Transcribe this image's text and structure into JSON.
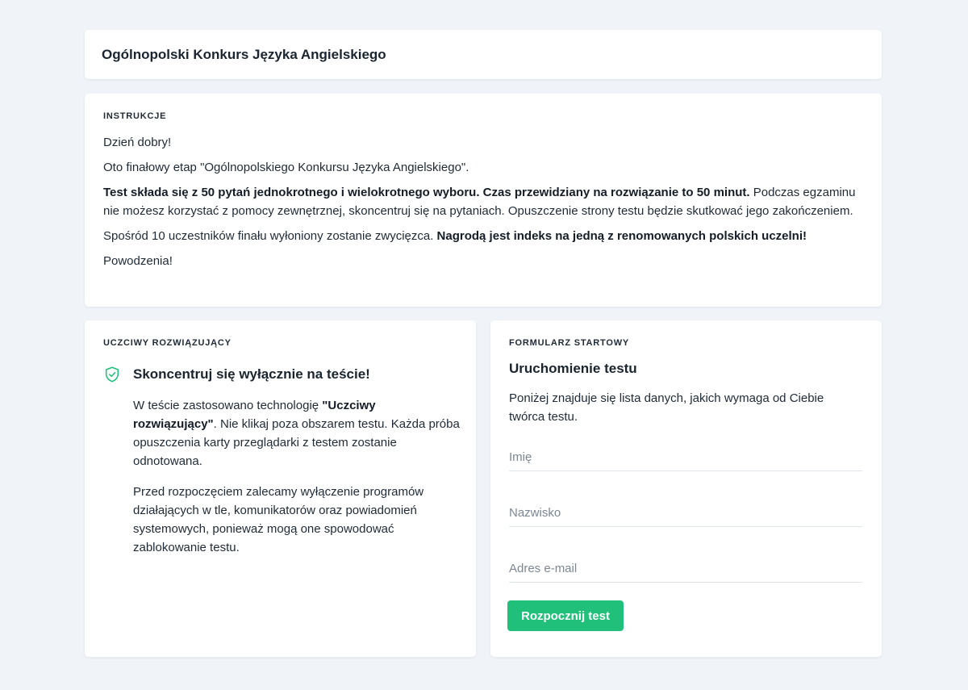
{
  "header": {
    "title": "Ogólnopolski Konkurs Języka Angielskiego"
  },
  "instructions": {
    "label": "INSTRUKCJE",
    "greeting": "Dzień dobry!",
    "intro": "Oto finałowy etap \"Ogólnopolskiego Konkursu Języka Angielskiego\".",
    "rules_bold": "Test składa się z 50 pytań jednokrotnego i wielokrotnego wyboru. Czas przewidziany na rozwiązanie to 50 minut.",
    "rules_rest": " Podczas egzaminu nie możesz korzystać z pomocy zewnętrznej, skoncentruj się na pytaniach. Opuszczenie strony testu będzie skutkować jego zakończeniem.",
    "prize_text": "Spośród 10 uczestników finału wyłoniony zostanie zwycięzca. ",
    "prize_bold": "Nagrodą jest indeks na jedną z renomowanych polskich uczelni!",
    "closing": "Powodzenia!"
  },
  "honest": {
    "label": "UCZCIWY ROZWIĄZUJĄCY",
    "icon": "shield-check-icon",
    "title": "Skoncentruj się wyłącznie na teście!",
    "p1_start": "W teście zastosowano technologię ",
    "p1_bold": "\"Uczciwy rozwiązujący\"",
    "p1_end": ". Nie klikaj poza obszarem testu. Każda próba opuszczenia karty przeglądarki z testem zostanie odnotowana.",
    "p2": "Przed rozpoczęciem zalecamy wyłączenie programów działających w tle, komunikatorów oraz powiadomień systemowych, ponieważ mogą one spowodować zablokowanie testu."
  },
  "form": {
    "label": "FORMULARZ STARTOWY",
    "title": "Uruchomienie testu",
    "description": "Poniżej znajduje się lista danych, jakich wymaga od Ciebie twórca testu.",
    "first_name_placeholder": "Imię",
    "last_name_placeholder": "Nazwisko",
    "email_placeholder": "Adres e-mail",
    "submit_label": "Rozpocznij test"
  },
  "colors": {
    "accent": "#21c07a",
    "background": "#f0f4f8",
    "card": "#ffffff",
    "text": "#1f2a37"
  }
}
